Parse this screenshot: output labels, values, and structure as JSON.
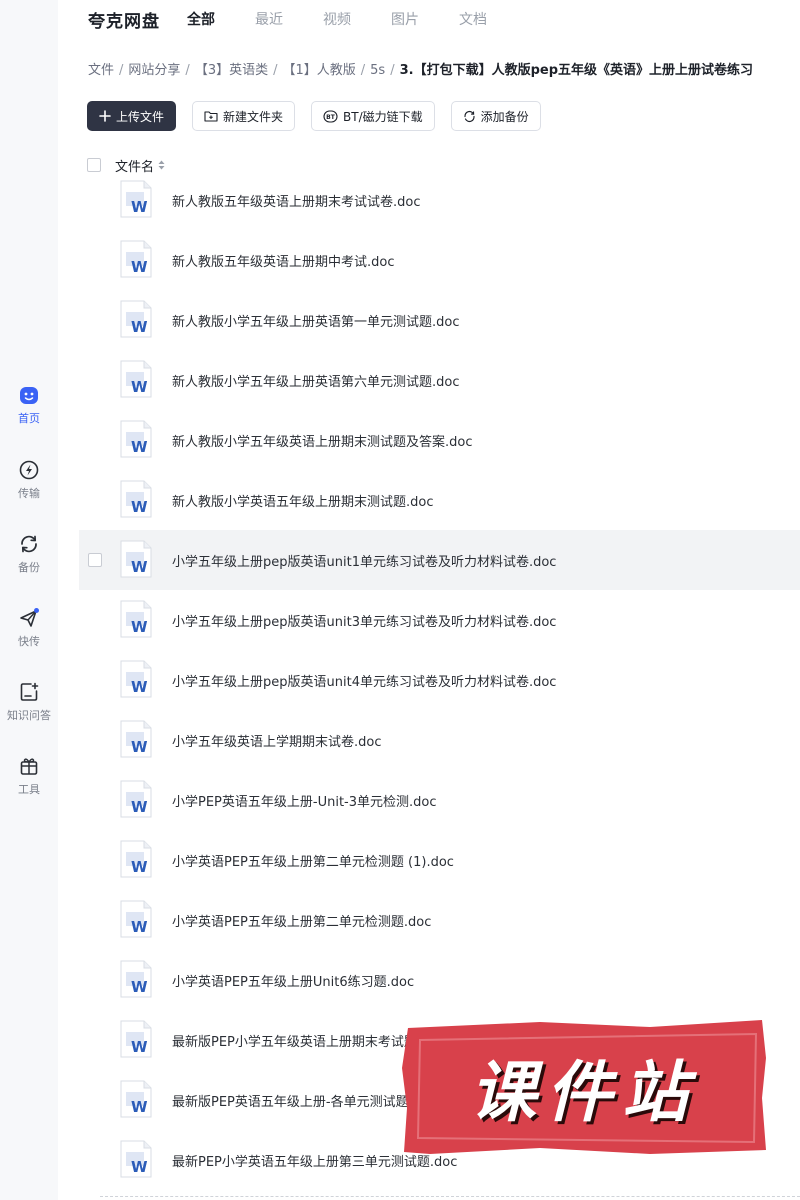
{
  "app": {
    "title": "夸克网盘"
  },
  "header": {
    "tabs": [
      {
        "label": "全部",
        "active": true
      },
      {
        "label": "最近"
      },
      {
        "label": "视频"
      },
      {
        "label": "图片"
      },
      {
        "label": "文档"
      }
    ]
  },
  "sidebar": {
    "items": [
      {
        "label": "首页",
        "icon": "smile-face-icon",
        "active": true
      },
      {
        "label": "传输",
        "icon": "transfer-bolt-icon"
      },
      {
        "label": "备份",
        "icon": "backup-sync-icon"
      },
      {
        "label": "快传",
        "icon": "paper-plane-icon",
        "badge": true
      },
      {
        "label": "知识问答",
        "icon": "knowledge-qa-icon"
      },
      {
        "label": "工具",
        "icon": "toolbox-icon"
      }
    ]
  },
  "breadcrumb": [
    "文件",
    "网站分享",
    "【3】英语类",
    "【1】人教版",
    "5s",
    "3.【打包下载】人教版pep五年级《英语》上册上册试卷练习"
  ],
  "toolbar": {
    "upload": "上传文件",
    "new_folder": "新建文件夹",
    "bt_download": "BT/磁力链下载",
    "add_backup": "添加备份"
  },
  "list": {
    "column_name": "文件名",
    "files": [
      "新人教版五年级英语上册期末考试试卷.doc",
      "新人教版五年级英语上册期中考试.doc",
      "新人教版小学五年级上册英语第一单元测试题.doc",
      "新人教版小学五年级上册英语第六单元测试题.doc",
      "新人教版小学五年级英语上册期末测试题及答案.doc",
      "新人教版小学英语五年级上册期末测试题.doc",
      "小学五年级上册pep版英语unit1单元练习试卷及听力材料试卷.doc",
      "小学五年级上册pep版英语unit3单元练习试卷及听力材料试卷.doc",
      "小学五年级上册pep版英语unit4单元练习试卷及听力材料试卷.doc",
      "小学五年级英语上学期期末试卷.doc",
      "小学PEP英语五年级上册-Unit-3单元检测.doc",
      "小学英语PEP五年级上册第二单元检测题 (1).doc",
      "小学英语PEP五年级上册第二单元检测题.doc",
      "小学英语PEP五年级上册Unit6练习题.doc",
      "最新版PEP小学五年级英语上册期末考试题打印.doc",
      "最新版PEP英语五年级上册-各单元测试题(unit1-unit 6).doc",
      "最新PEP小学英语五年级上册第三单元测试题.doc"
    ],
    "hover_index": 6
  },
  "watermark": {
    "text": "课件站"
  },
  "colors": {
    "accent": "#3a62f5",
    "primary_button": "#2f3444",
    "word_blue": "#2b5cb8",
    "stamp_red": "#d8414b"
  }
}
